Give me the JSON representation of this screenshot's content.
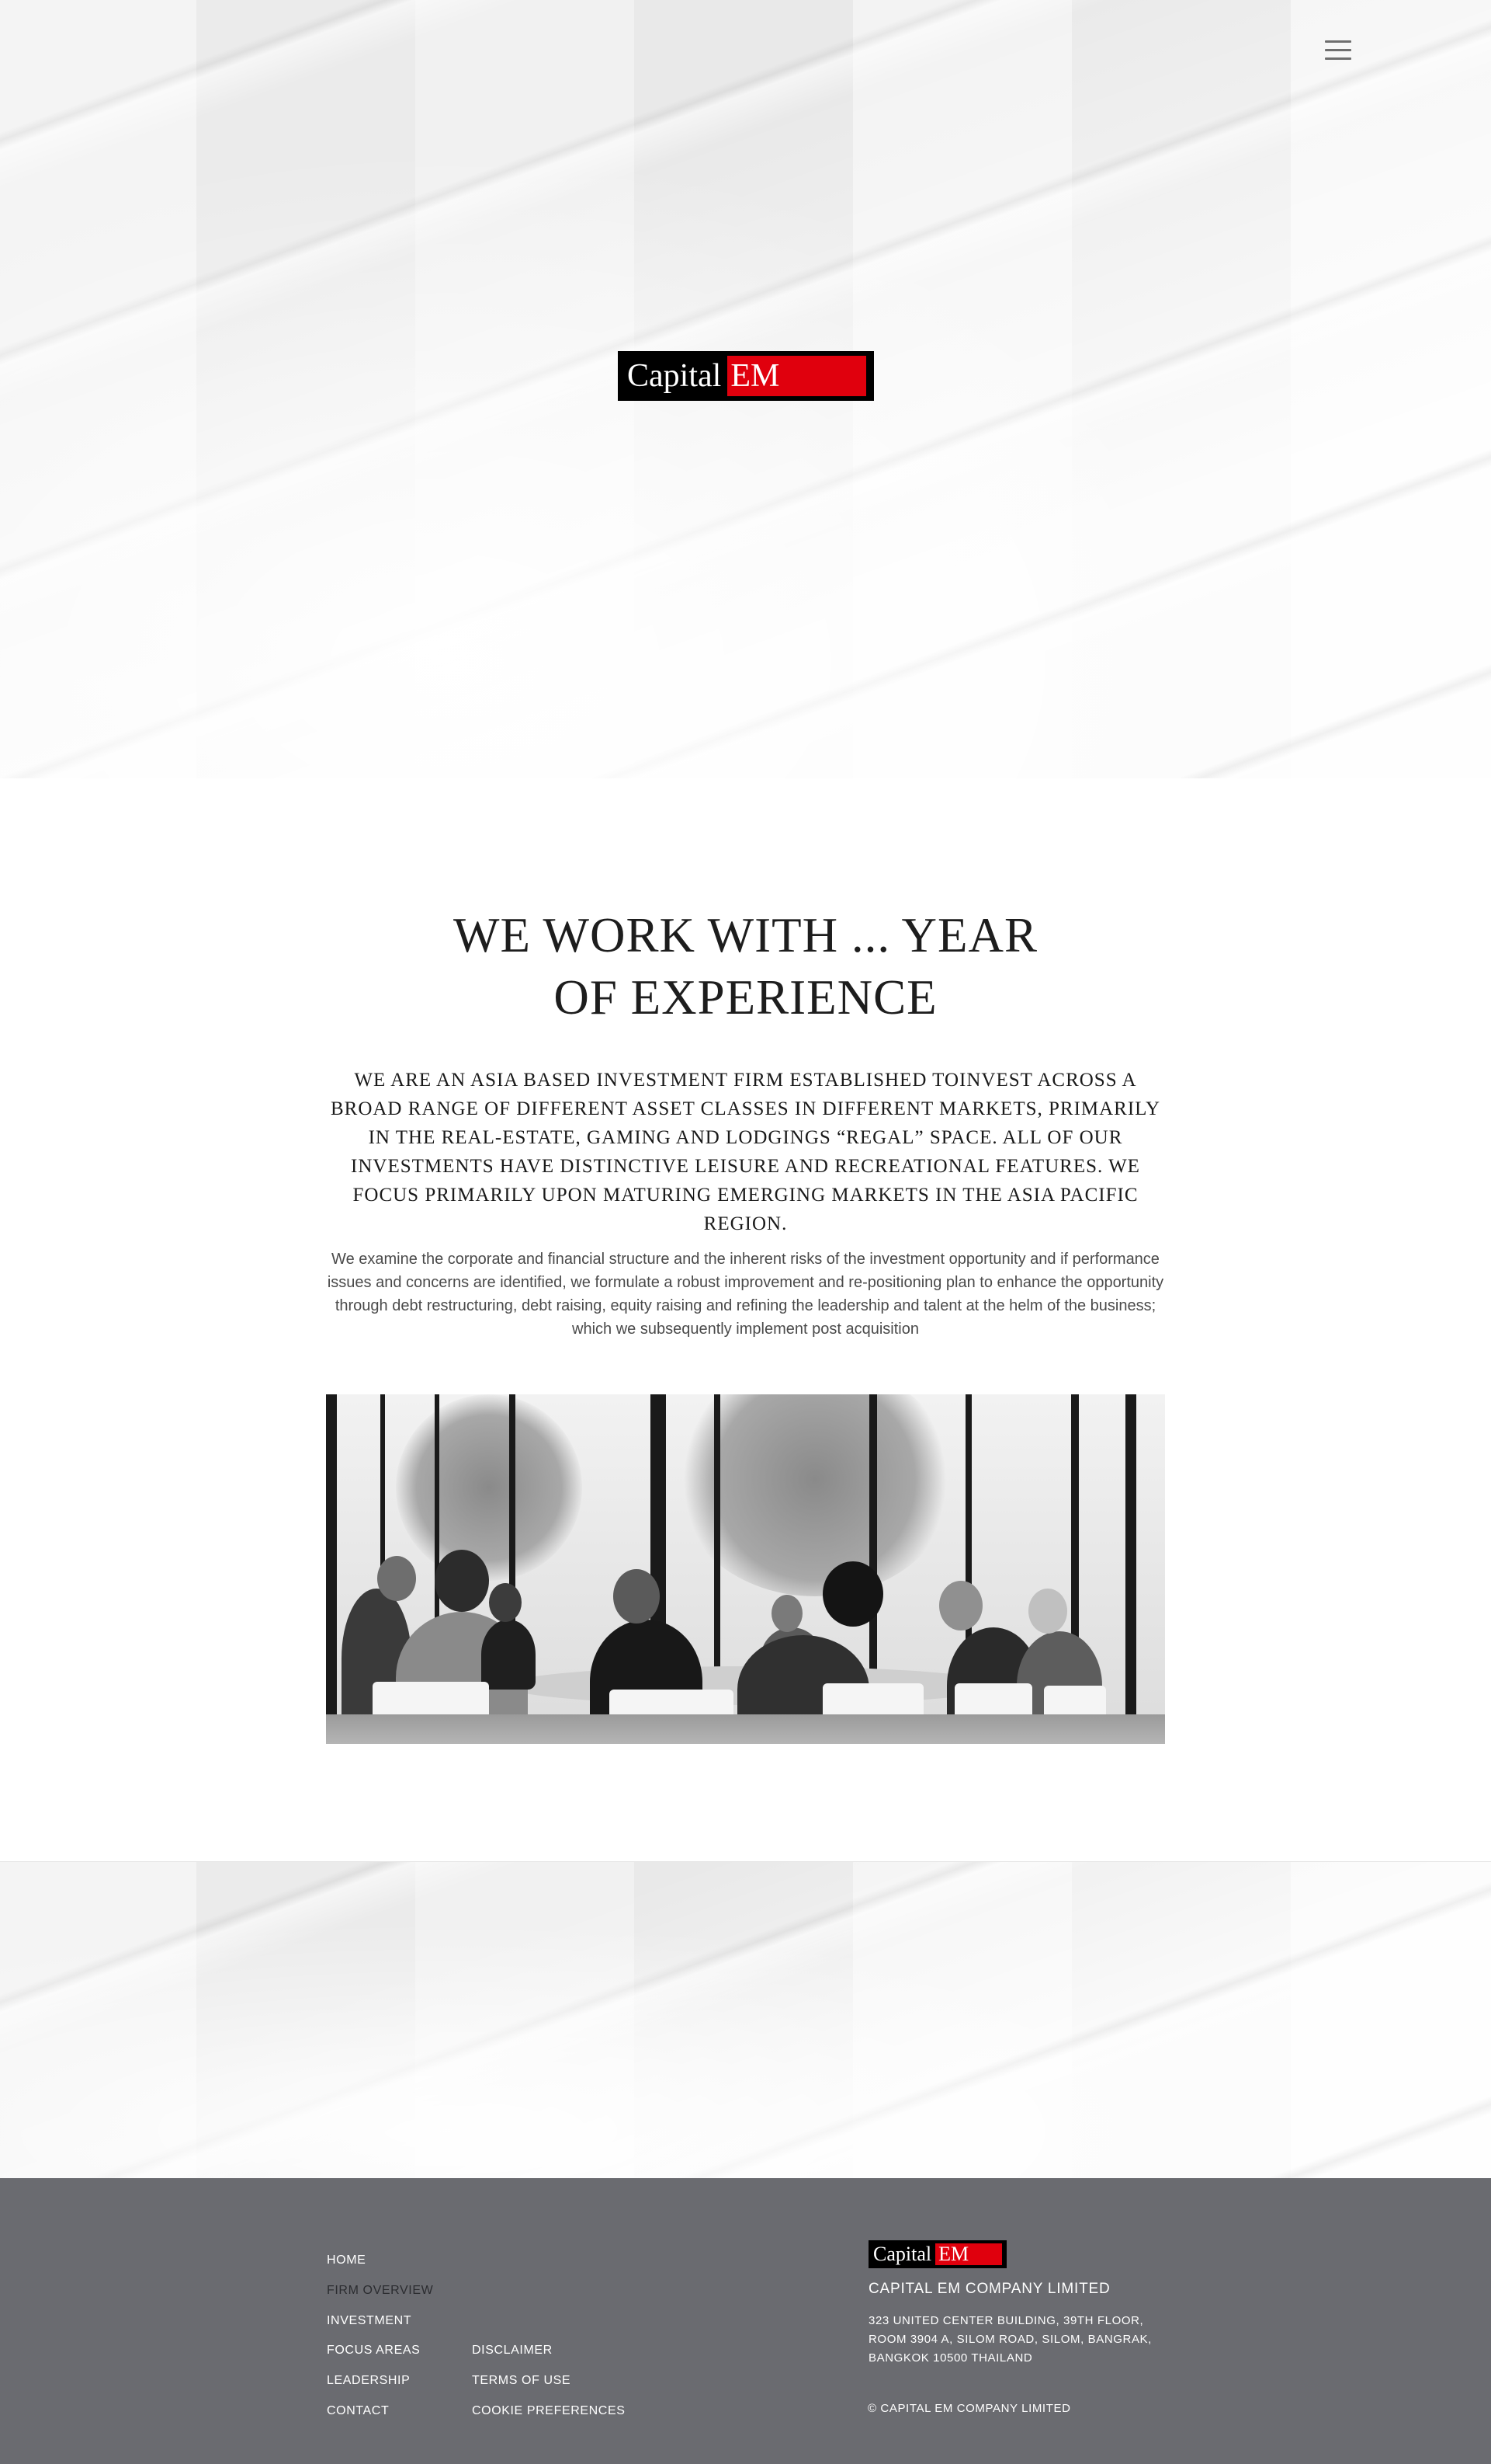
{
  "header": {
    "menu_icon": "hamburger-menu-icon",
    "logo": {
      "part1": "Capital",
      "part2": "EM",
      "color_bg": "#000000",
      "color_accent": "#e0000d"
    }
  },
  "main": {
    "headline_line1": "WE WORK WITH ... YEAR",
    "headline_line2": "OF EXPERIENCE",
    "intro": "We are an Asia based investment firm established toinvest across a broad range of different asset classes in different markets, primarily in the real-estate, gaming and lodgings “regal” space. All of our investments have distinctive leisure and recreational features. We focus primarily upon maturing emerging markets in the Asia Pacific region.",
    "body": "We examine the corporate and financial structure and the inherent risks of the investment opportunity and if performance issues and concerns are identified, we formulate a robust improvement and re-positioning plan to enhance the opportunity through debt restructuring, debt raising, equity raising and refining the leadership and talent at the helm of the business; which we subsequently implement post acquisition"
  },
  "footer": {
    "nav_col1": [
      "HOME",
      "FIRM OVERVIEW",
      "INVESTMENT",
      "FOCUS AREAS",
      "LEADERSHIP",
      "CONTACT"
    ],
    "nav_col2": [
      "DISCLAIMER",
      "TERMS OF USE",
      "COOKIE PREFERENCES"
    ],
    "active_item": "FIRM OVERVIEW",
    "logo": {
      "part1": "Capital",
      "part2": "EM"
    },
    "company_name": "CAPITAL EM COMPANY LIMITED",
    "address_line1": "323 UNITED CENTER BUILDING, 39TH FLOOR,",
    "address_line2": "ROOM 3904 A, SILOM ROAD, SILOM, BANGRAK,",
    "address_line3": "BANGKOK 10500 THAILAND",
    "copyright": "© CAPITAL EM COMPANY LIMITED",
    "colors": {
      "background": "#6a6b70",
      "text": "#ffffff",
      "active_text": "#2b2c30"
    }
  }
}
